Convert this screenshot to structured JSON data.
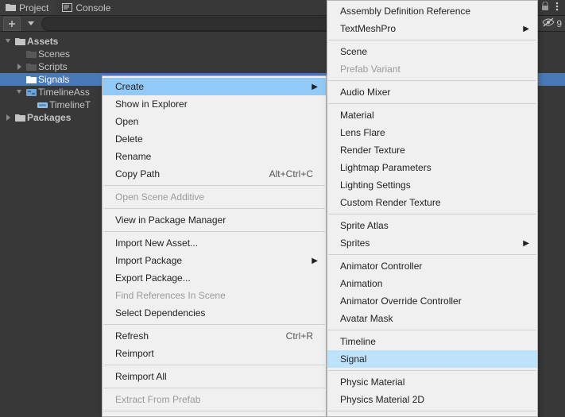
{
  "tabs": {
    "project": "Project",
    "console": "Console"
  },
  "toolbar": {
    "search_placeholder": "",
    "visibility_count": "9"
  },
  "tree": {
    "assets": "Assets",
    "scenes": "Scenes",
    "scripts": "Scripts",
    "signals": "Signals",
    "timelineAsset": "TimelineAss",
    "timelineT": "TimelineT",
    "packages": "Packages"
  },
  "menu1": {
    "create": "Create",
    "showInExplorer": "Show in Explorer",
    "open": "Open",
    "delete": "Delete",
    "rename": "Rename",
    "copyPath": "Copy Path",
    "copyPathShortcut": "Alt+Ctrl+C",
    "openSceneAdditive": "Open Scene Additive",
    "viewInPackageManager": "View in Package Manager",
    "importNewAsset": "Import New Asset...",
    "importPackage": "Import Package",
    "exportPackage": "Export Package...",
    "findReferences": "Find References In Scene",
    "selectDependencies": "Select Dependencies",
    "refresh": "Refresh",
    "refreshShortcut": "Ctrl+R",
    "reimport": "Reimport",
    "reimportAll": "Reimport All",
    "extractFromPrefab": "Extract From Prefab"
  },
  "menu2": {
    "asmdefRef": "Assembly Definition Reference",
    "textMeshPro": "TextMeshPro",
    "scene": "Scene",
    "prefabVariant": "Prefab Variant",
    "audioMixer": "Audio Mixer",
    "material": "Material",
    "lensFlare": "Lens Flare",
    "renderTexture": "Render Texture",
    "lightmapParams": "Lightmap Parameters",
    "lightingSettings": "Lighting Settings",
    "customRenderTexture": "Custom Render Texture",
    "spriteAtlas": "Sprite Atlas",
    "sprites": "Sprites",
    "animatorController": "Animator Controller",
    "animation": "Animation",
    "animatorOverride": "Animator Override Controller",
    "avatarMask": "Avatar Mask",
    "timeline": "Timeline",
    "signal": "Signal",
    "physicMaterial": "Physic Material",
    "physicsMaterial2d": "Physics Material 2D"
  }
}
